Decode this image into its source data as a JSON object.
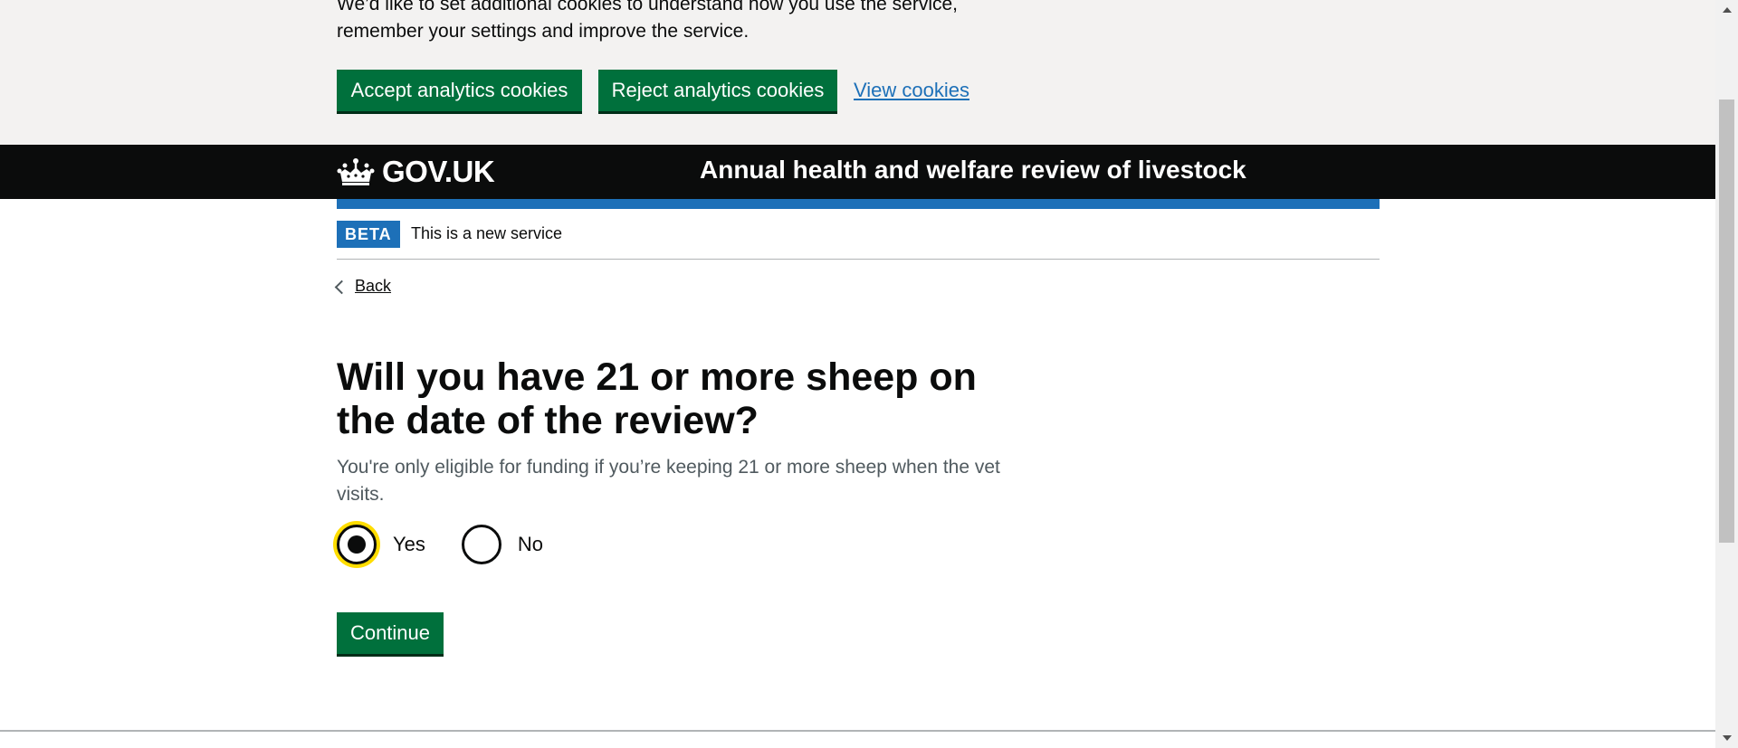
{
  "cookie_banner": {
    "text": "We’d like to set additional cookies to understand how you use the service, remember your settings and improve the service.",
    "accept_label": "Accept analytics cookies",
    "reject_label": "Reject analytics cookies",
    "view_label": "View cookies"
  },
  "header": {
    "logo_text": "GOV.UK",
    "service_name": "Annual health and welfare review of livestock"
  },
  "phase_banner": {
    "tag": "BETA",
    "text": "This is a new service"
  },
  "back_label": "Back",
  "question": {
    "title": "Will you have 21 or more sheep on the date of the review?",
    "hint": "You're only eligible for funding if you’re keeping 21 or more sheep when the vet visits.",
    "options": [
      {
        "label": "Yes",
        "checked": true
      },
      {
        "label": "No",
        "checked": false
      }
    ]
  },
  "continue_label": "Continue",
  "colors": {
    "brand_green": "#00703c",
    "link_blue": "#1d70b8",
    "focus_yellow": "#ffdd00",
    "header_black": "#0b0c0c"
  },
  "icons": [
    "crown-icon",
    "chevron-left-icon"
  ]
}
